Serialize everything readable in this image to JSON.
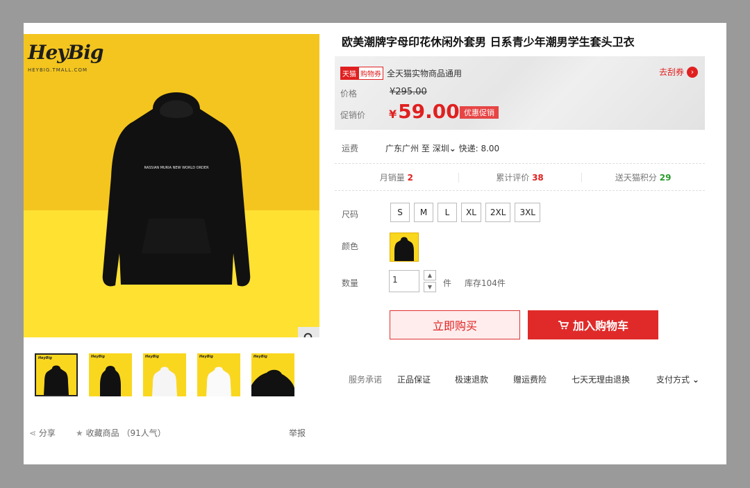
{
  "gallery": {
    "brand": "HeyBig",
    "brand_sub": "HEYBIG.TMALL.COM",
    "print_text": "RASSIAN MURIA NEW WORLD ORDER",
    "thumbnails": [
      {
        "color": "black",
        "active": true
      },
      {
        "color": "black",
        "active": false
      },
      {
        "color": "white",
        "active": false
      },
      {
        "color": "white",
        "active": false
      },
      {
        "color": "black",
        "active": false
      }
    ]
  },
  "actions": {
    "share": "分享",
    "favorite": "收藏商品",
    "popularity": "（91人气）",
    "report": "举报"
  },
  "product": {
    "title": "欧美潮牌字母印花休闲外套男 日系青少年潮男学生套头卫衣"
  },
  "coupon": {
    "tag_tmall": "天猫",
    "tag_coupon": "购物券",
    "text": "全天猫实物商品通用",
    "link": "去刮券"
  },
  "price": {
    "label": "价格",
    "original": "¥295.00",
    "promo_label": "促销价",
    "currency": "¥",
    "promo": "59.00",
    "promo_tag": "优惠促销"
  },
  "shipping": {
    "label": "运费",
    "from": "广东广州",
    "to_word": "至",
    "to": "深圳",
    "fee": "快递: 8.00"
  },
  "stats": {
    "sales_label": "月销量",
    "sales": "2",
    "reviews_label": "累计评价",
    "reviews": "38",
    "points_label": "送天猫积分",
    "points": "29"
  },
  "options": {
    "size_label": "尺码",
    "sizes": [
      "S",
      "M",
      "L",
      "XL",
      "2XL",
      "3XL"
    ],
    "color_label": "颜色",
    "qty_label": "数量",
    "qty": "1",
    "unit": "件",
    "stock": "库存104件"
  },
  "buttons": {
    "buy_now": "立即购买",
    "add_cart": "加入购物车"
  },
  "service": {
    "label": "服务承诺",
    "items": [
      "正品保证",
      "极速退款",
      "赠运费险",
      "七天无理由退换"
    ],
    "payment": "支付方式"
  },
  "colors": {
    "accent": "#e02020",
    "background_yellow": "#f7cc1f"
  }
}
